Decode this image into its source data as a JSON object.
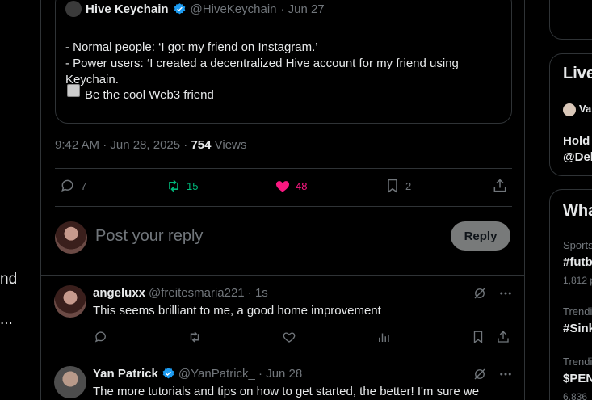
{
  "left": {
    "fragment_1": "nd",
    "fragment_2": "..."
  },
  "quoted_tweet": {
    "author_name": "Hive Keychain",
    "author_handle": "@HiveKeychain",
    "date": "· Jun 27",
    "lines": [
      "- Normal people: ‘I got my friend on Instagram.’",
      "- Power users: ‘I created a decentralized Hive account for my friend using Keychain.",
      ""
    ],
    "image_alt": "Be the cool Web3 friend"
  },
  "meta": {
    "time": "9:42 AM · Jun 28, 2025 · ",
    "views_count": "754",
    "views_label": " Views"
  },
  "actions": {
    "replies": "7",
    "reposts": "15",
    "likes": "48",
    "bookmarks": "2"
  },
  "reply_box": {
    "placeholder": "Post your reply",
    "button": "Reply"
  },
  "replies": [
    {
      "name": "angeluxx",
      "handle": "@freitesmaria221 · 1s",
      "text": "This seems brilliant to me, a good home improvement"
    },
    {
      "name": "Yan Patrick",
      "handle": "@YanPatrick_ · Jun 28",
      "text": "The more tutorials and tips on how to get started, the better! I'm sure we"
    }
  ],
  "sidebar": {
    "live_title": "Live",
    "live_item": "Va",
    "live_line1": "Hold",
    "live_line2": "@Del",
    "whats_title": "Wha",
    "trend1_cat": "Sports",
    "trend1_tag": "#futb",
    "trend1_count": "1,812 p",
    "trend2_cat": "Trendi",
    "trend2_tag": "#Sink",
    "trend3_cat": "Trendi",
    "trend3_tag": "$PEN",
    "trend3_count": "6,836"
  },
  "colors": {
    "repost": "#00ba7c",
    "like": "#f91880",
    "verified": "#1d9bf0",
    "muted": "#71767b"
  }
}
